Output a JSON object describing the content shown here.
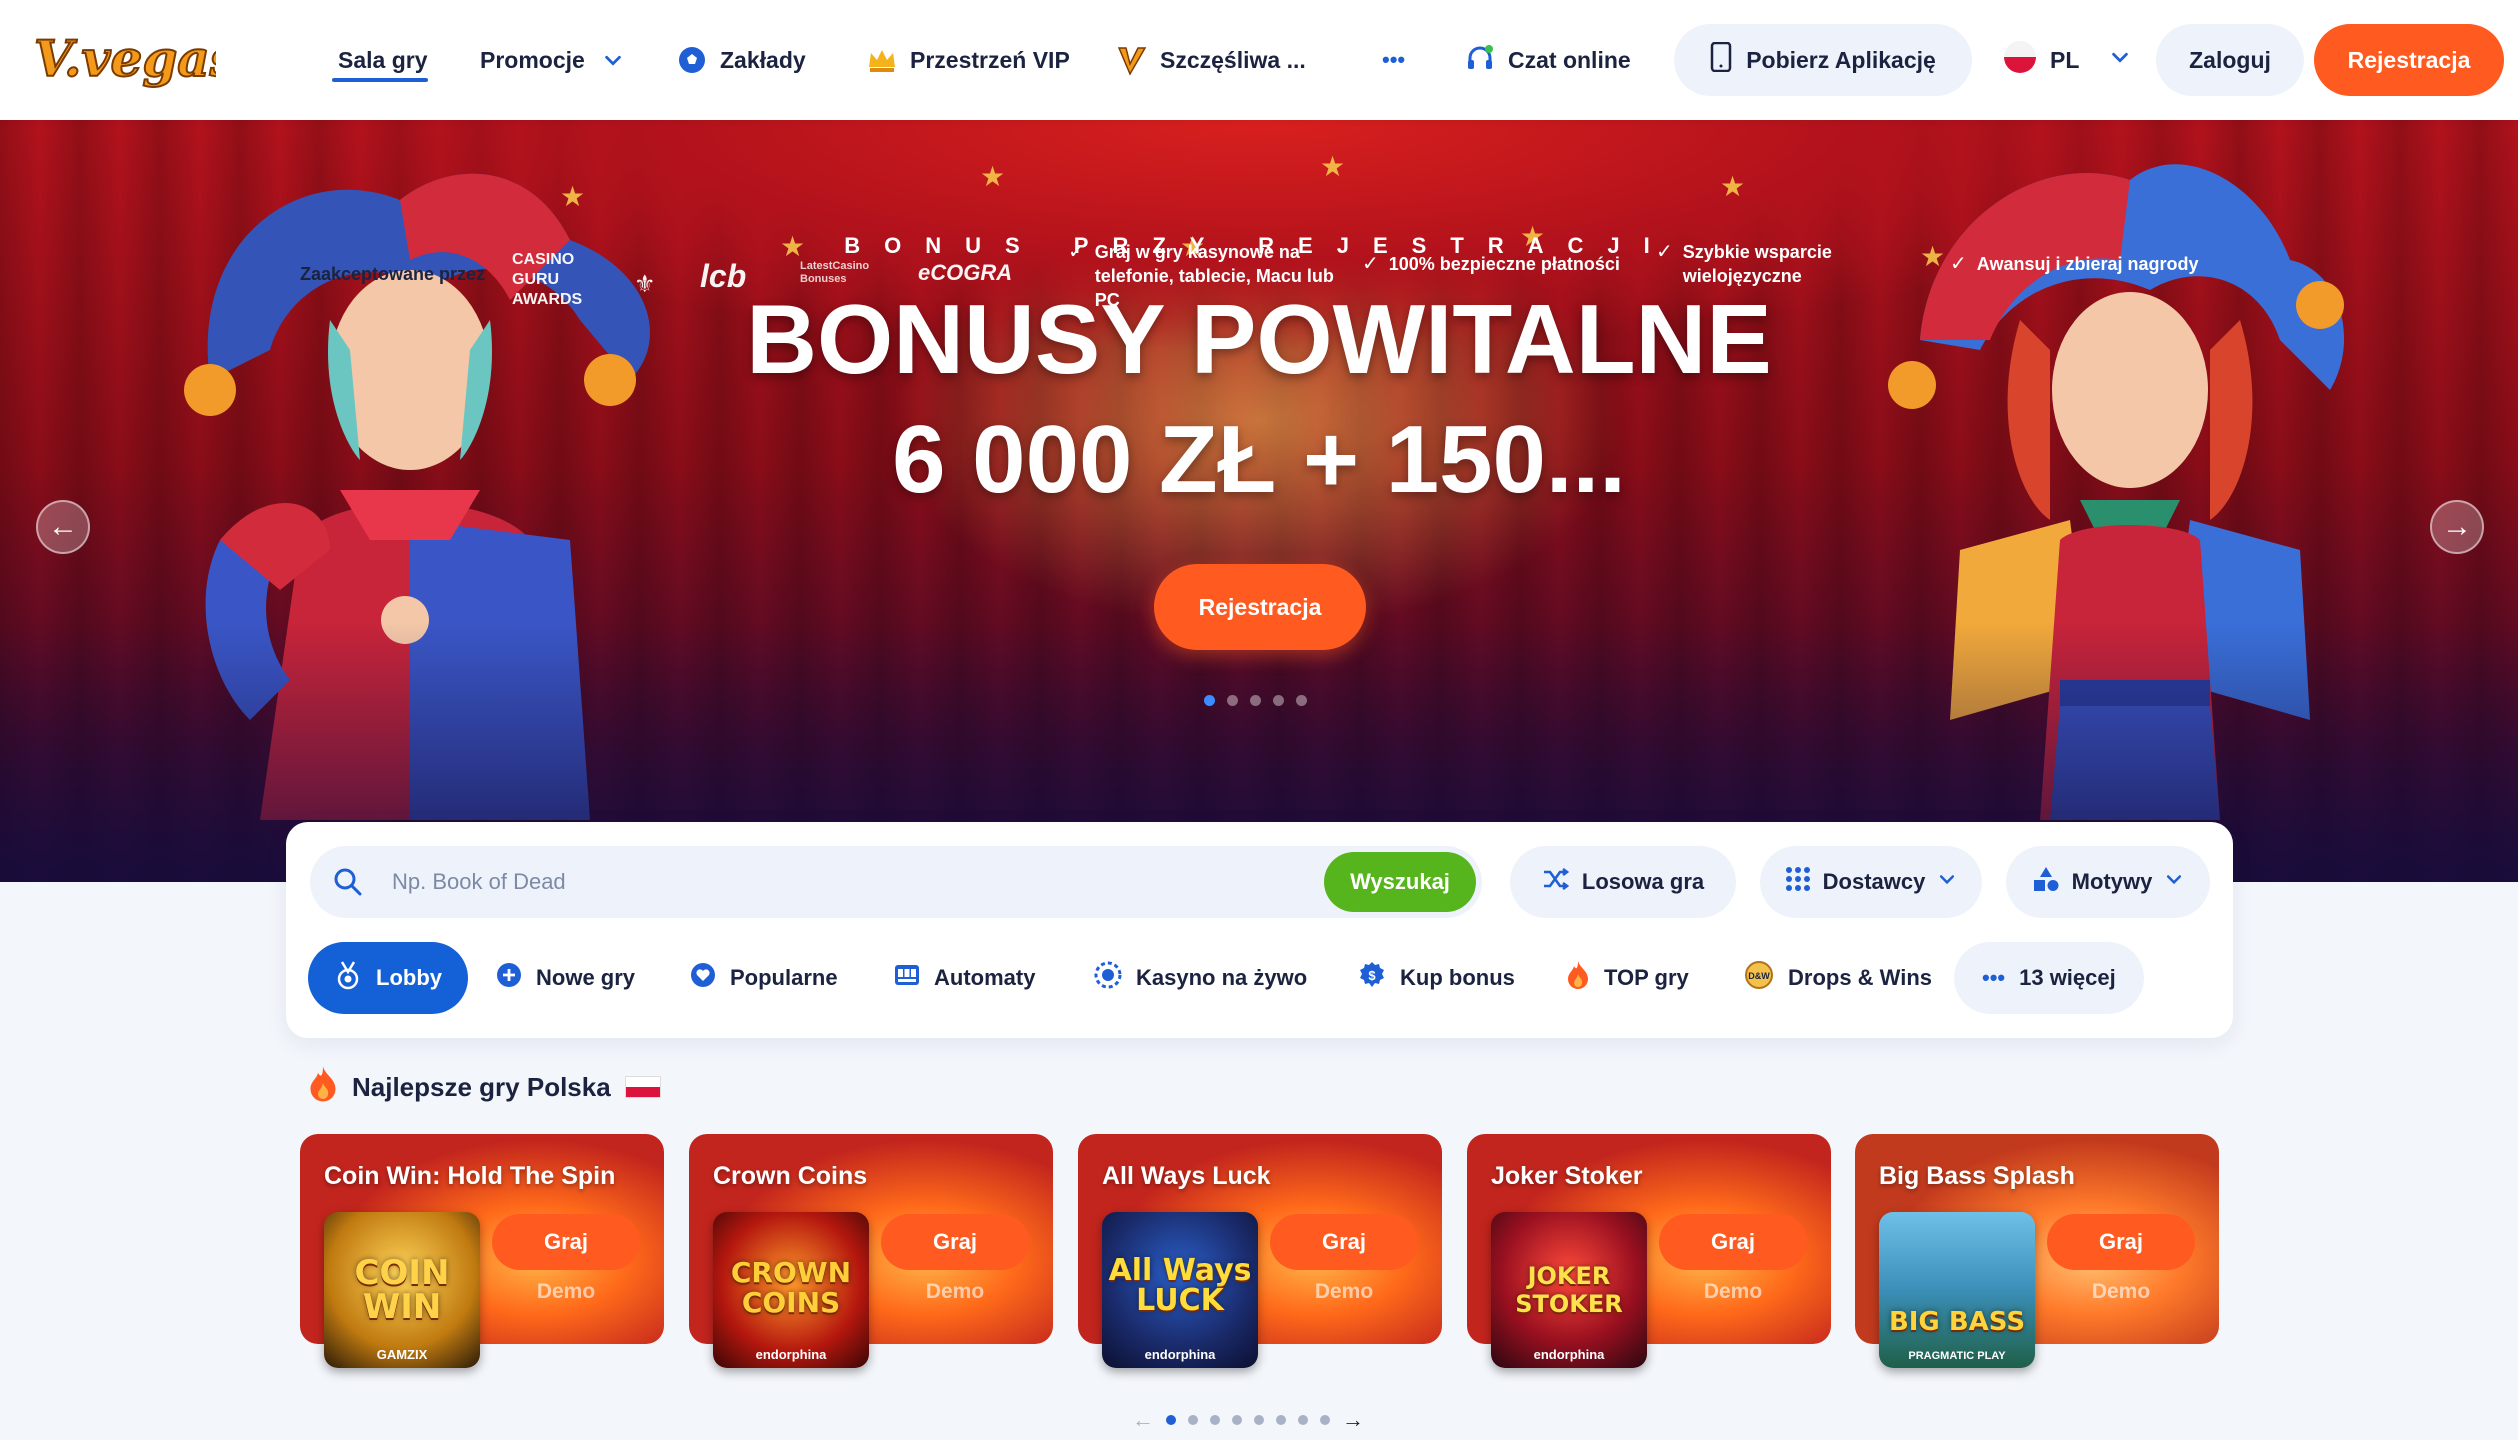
{
  "header": {
    "logo_text": "V.vegas",
    "nav": [
      {
        "label": "Sala gry",
        "active": true
      },
      {
        "label": "Promocje"
      },
      {
        "label": "Zakłady"
      },
      {
        "label": "Przestrzeń VIP"
      },
      {
        "label": "Szczęśliwa ..."
      },
      {
        "label": "•••"
      },
      {
        "label": "Czat online"
      }
    ],
    "app_button": "Pobierz Aplikację",
    "language": "PL",
    "login": "Zaloguj",
    "register": "Rejestracja"
  },
  "hero": {
    "kicker": "BONUS PRZY REJESTRACJI",
    "title": "BONUSY POWITALNE",
    "subtitle": "6 000 ZŁ + 150...",
    "cta": "Rejestracja",
    "slides_count": 5,
    "active_slide": 1,
    "trust_label": "Zaakceptowane przez",
    "trust_logos": [
      "CASINO GURU AWARDS",
      "lcb",
      "LatestCasino Bonuses",
      "eCOGRA"
    ],
    "features": [
      "Graj w gry kasynowe na telefonie, tablecie, Macu lub PC",
      "100% bezpieczne płatności",
      "Szybkie wsparcie wielojęzyczne",
      "Awansuj i zbieraj nagrody"
    ]
  },
  "search": {
    "placeholder": "Np. Book of Dead",
    "value": "",
    "button": "Wyszukaj",
    "random": "Losowa gra",
    "providers": "Dostawcy",
    "themes": "Motywy"
  },
  "categories": [
    {
      "label": "Lobby",
      "active": true
    },
    {
      "label": "Nowe gry"
    },
    {
      "label": "Popularne"
    },
    {
      "label": "Automaty"
    },
    {
      "label": "Kasyno na żywo"
    },
    {
      "label": "Kup bonus"
    },
    {
      "label": "TOP gry"
    },
    {
      "label": "Drops & Wins"
    },
    {
      "label": "13 więcej"
    }
  ],
  "top_games": {
    "title": "Najlepsze gry Polska",
    "play_label": "Graj",
    "demo_label": "Demo",
    "games": [
      {
        "title": "Coin Win: Hold The Spin",
        "thumb": "COIN WIN",
        "provider": "GAMZIX"
      },
      {
        "title": "Crown Coins",
        "thumb": "CROWN COINS",
        "provider": "endorphina"
      },
      {
        "title": "All Ways Luck",
        "thumb": "All Ways LUCK",
        "provider": "endorphina"
      },
      {
        "title": "Joker Stoker",
        "thumb": "JOKER STOKER",
        "provider": "endorphina"
      },
      {
        "title": "Big Bass Splash",
        "thumb": "BIG BASS",
        "provider": "PRAGMATIC PLAY"
      }
    ],
    "pages": 8,
    "active_page": 1
  },
  "colors": {
    "accent_orange": "#ff5a1f",
    "primary_blue": "#1460d6",
    "search_green": "#56b51c",
    "text_dark": "#1b2340"
  }
}
